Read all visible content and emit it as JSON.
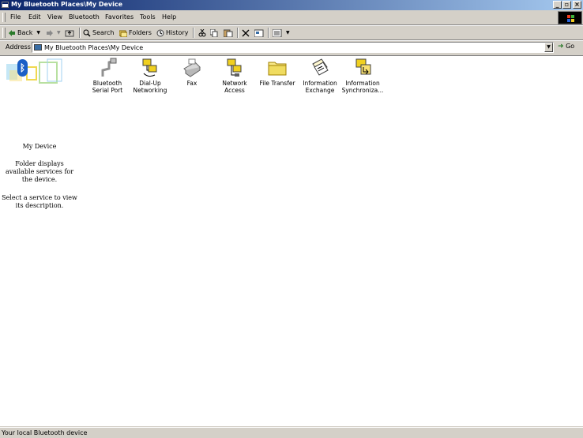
{
  "window": {
    "title": "My Bluetooth Places\\My Device"
  },
  "menu": [
    "File",
    "Edit",
    "View",
    "Bluetooth",
    "Favorites",
    "Tools",
    "Help"
  ],
  "toolbar": {
    "back": "Back",
    "search": "Search",
    "folders": "Folders",
    "history": "History"
  },
  "address": {
    "label": "Address",
    "value": "My Bluetooth Places\\My Device",
    "go": "Go"
  },
  "sidebar": {
    "title": "My Device",
    "desc": "Folder displays available services for the device.",
    "hint": "Select a service to view its description."
  },
  "services": [
    {
      "label": "Bluetooth\nSerial Port",
      "icon": "serial-port-icon"
    },
    {
      "label": "Dial-Up\nNetworking",
      "icon": "dial-up-icon"
    },
    {
      "label": "Fax",
      "icon": "fax-icon"
    },
    {
      "label": "Network\nAccess",
      "icon": "network-access-icon"
    },
    {
      "label": "File Transfer",
      "icon": "folder-icon"
    },
    {
      "label": "Information\nExchange",
      "icon": "information-exchange-icon"
    },
    {
      "label": "Information\nSynchroniza...",
      "icon": "information-sync-icon"
    }
  ],
  "status": {
    "text": "Your local Bluetooth device"
  }
}
